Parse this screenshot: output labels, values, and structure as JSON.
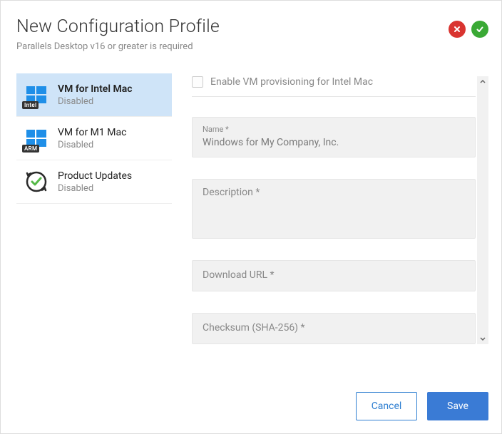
{
  "header": {
    "title": "New Configuration Profile",
    "subtitle": "Parallels Desktop v16 or greater is required"
  },
  "sidebar": {
    "items": [
      {
        "label": "VM for Intel Mac",
        "status": "Disabled",
        "arch": "Intel"
      },
      {
        "label": "VM for M1 Mac",
        "status": "Disabled",
        "arch": "ARM"
      },
      {
        "label": "Product Updates",
        "status": "Disabled"
      }
    ]
  },
  "form": {
    "enable_label": "Enable VM provisioning for Intel Mac",
    "name_label": "Name *",
    "name_value": "Windows for My Company, Inc.",
    "description_label": "Description *",
    "download_url_label": "Download URL *",
    "checksum_label": "Checksum (SHA-256) *"
  },
  "footer": {
    "cancel": "Cancel",
    "save": "Save"
  }
}
